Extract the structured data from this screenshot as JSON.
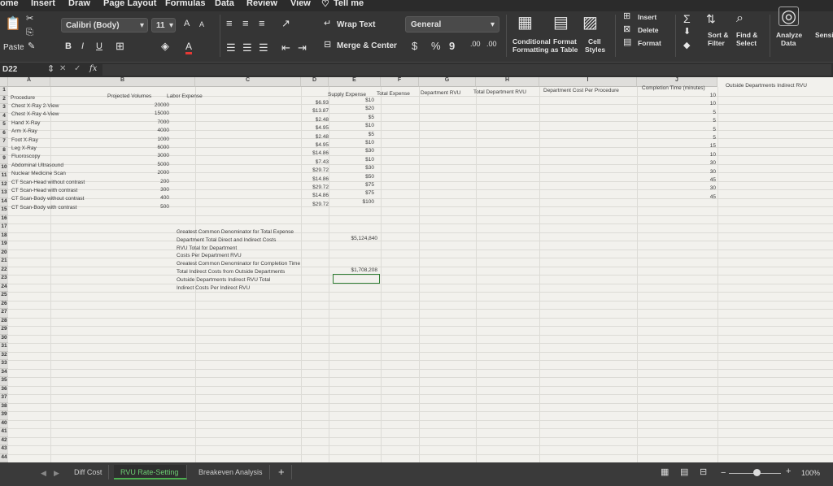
{
  "menu": {
    "home": "ome",
    "insert": "Insert",
    "draw": "Draw",
    "page_layout": "Page Layout",
    "formulas": "Formulas",
    "data": "Data",
    "review": "Review",
    "view": "View",
    "tell_me": "Tell me"
  },
  "ribbon": {
    "paste": "Paste",
    "font_name": "Calibri (Body)",
    "font_size": "11",
    "bold": "B",
    "italic": "I",
    "underline": "U",
    "grow_font": "A",
    "shrink_font": "A",
    "font_color": "A",
    "wrap_text": "Wrap Text",
    "merge_center": "Merge & Center",
    "number_format": "General",
    "currency": "$",
    "percent": "%",
    "comma": "9",
    "inc_decimal": ".00",
    "dec_decimal": ".00",
    "conditional_formatting_1": "Conditional",
    "conditional_formatting_2": "Formatting",
    "format_table_1": "Format",
    "format_table_2": "as Table",
    "cell_styles_1": "Cell",
    "cell_styles_2": "Styles",
    "insert": "Insert",
    "delete": "Delete",
    "format": "Format",
    "sort_filter_1": "Sort &",
    "sort_filter_2": "Filter",
    "find_select_1": "Find &",
    "find_select_2": "Select",
    "analyze_data_1": "Analyze",
    "analyze_data_2": "Data",
    "sensitivity": "Sensi"
  },
  "formula_bar": {
    "name_box": "D22",
    "fx": "fx"
  },
  "columns": [
    "A",
    "B",
    "C",
    "D",
    "E",
    "F",
    "G",
    "H",
    "I",
    "J"
  ],
  "rows": [
    "1",
    "2",
    "3",
    "4",
    "5",
    "6",
    "7",
    "8",
    "9",
    "10",
    "11",
    "12",
    "13",
    "14",
    "15",
    "16",
    "17",
    "18",
    "19",
    "20",
    "21",
    "22",
    "23",
    "24",
    "25",
    "26",
    "27",
    "28",
    "29",
    "30",
    "31",
    "32",
    "33",
    "34",
    "35",
    "36",
    "37",
    "38",
    "39",
    "40",
    "41",
    "42",
    "43",
    "44"
  ],
  "headers": {
    "procedure": "Procedure",
    "projected_volumes": "Projected Volumes",
    "labor_expense": "Labor Expense",
    "supply_expense": "Supply Expense",
    "total_expense": "Total Expense",
    "department_rvu": "Department RVU",
    "total_department_rvu": "Total Department RVU",
    "department_cost_per_procedure": "Department Cost Per Procedure",
    "completion_time": "Completion Time (minutes)",
    "outside_departments_indirect_rvu": "Outside Departments Indirect RVU"
  },
  "procedures": [
    {
      "name": "Chest X-Ray 2-View",
      "volume": "20000",
      "labor": "$6.93",
      "supply": "$10",
      "time": "10"
    },
    {
      "name": "Chest X-Ray 4-View",
      "volume": "15000",
      "labor": "$13.87",
      "supply": "$20",
      "time": "10"
    },
    {
      "name": "Hand X-Ray",
      "volume": "7000",
      "labor": "$2.48",
      "supply": "$5",
      "time": "5"
    },
    {
      "name": "Arm X-Ray",
      "volume": "4000",
      "labor": "$4.95",
      "supply": "$10",
      "time": "5"
    },
    {
      "name": "Foot X-Ray",
      "volume": "1000",
      "labor": "$2.48",
      "supply": "$5",
      "time": "5"
    },
    {
      "name": "Leg X-Ray",
      "volume": "6000",
      "labor": "$4.95",
      "supply": "$10",
      "time": "5"
    },
    {
      "name": "Fluoroscopy",
      "volume": "3000",
      "labor": "$14.86",
      "supply": "$30",
      "time": "15"
    },
    {
      "name": "Abdominal Ultrasound",
      "volume": "5000",
      "labor": "$7.43",
      "supply": "$10",
      "time": "10"
    },
    {
      "name": "Nuclear Medicine Scan",
      "volume": "2000",
      "labor": "$29.72",
      "supply": "$30",
      "time": "30"
    },
    {
      "name": "CT Scan-Head without contrast",
      "volume": "200",
      "labor": "$14.86",
      "supply": "$50",
      "time": "30"
    },
    {
      "name": "CT Scan-Head with contrast",
      "volume": "300",
      "labor": "$29.72",
      "supply": "$75",
      "time": "45"
    },
    {
      "name": "CT Scan-Body without contrast",
      "volume": "400",
      "labor": "$14.86",
      "supply": "$75",
      "time": "30"
    },
    {
      "name": "CT Scan-Body with contrast",
      "volume": "500",
      "labor": "$29.72",
      "supply": "$100",
      "time": "45"
    }
  ],
  "summary": [
    {
      "label": "Greatest Common Denominator for Total Expense",
      "value": ""
    },
    {
      "label": "Department Total Direct and Indirect Costs",
      "value": "$5,124,840"
    },
    {
      "label": "RVU Total for Department",
      "value": ""
    },
    {
      "label": "Costs Per Department RVU",
      "value": ""
    },
    {
      "label": "Greatest Common Denominator for Completion Time",
      "value": ""
    },
    {
      "label": "Total Indirect Costs from Outside Departments",
      "value": "$1,708,208"
    },
    {
      "label": "Outside Departments Indirect RVU Total",
      "value": ""
    },
    {
      "label": "Indirect Costs Per Indirect RVU",
      "value": ""
    }
  ],
  "sheet_tabs": {
    "diff_cost": "Diff Cost",
    "rvu_rate_setting": "RVU Rate-Setting",
    "breakeven_analysis": "Breakeven Analysis",
    "add": "+"
  },
  "status": {
    "zoom": "100%"
  },
  "colors": {
    "accent": "#2e7d32",
    "active_tab": "#4caf50"
  }
}
